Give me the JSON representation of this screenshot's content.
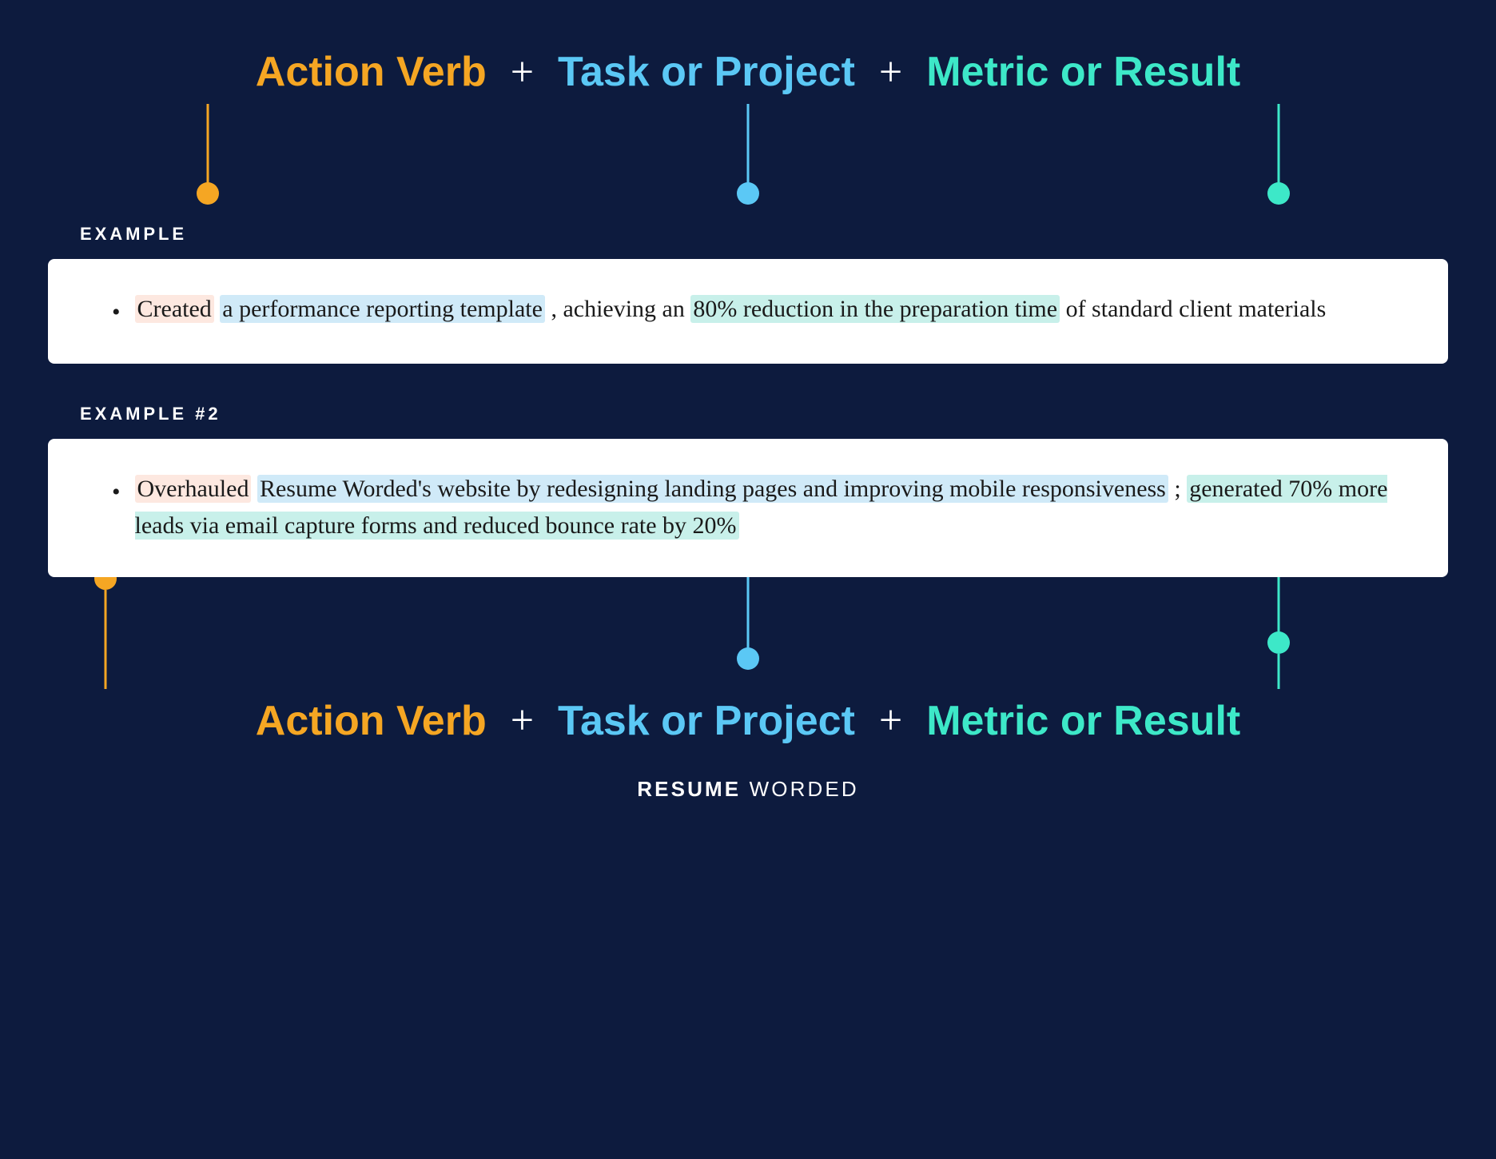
{
  "colors": {
    "background": "#0d1b3e",
    "orange": "#f5a623",
    "blue": "#5bc8f5",
    "teal": "#3de8c8",
    "white": "#ffffff",
    "highlight_orange": "#fde8e0",
    "highlight_blue": "#d0eaf8",
    "highlight_teal": "#c8f0ea"
  },
  "header": {
    "action_verb": "Action Verb",
    "task_or_project": "Task or Project",
    "metric_or_result": "Metric or Result",
    "plus": "+"
  },
  "example1": {
    "label": "EXAMPLE",
    "text_plain": "Created",
    "text_task": "a performance reporting template",
    "text_middle": ", achieving an ",
    "text_metric": "80% reduction in the preparation time",
    "text_end": "of standard client materials"
  },
  "example2": {
    "label": "EXAMPLE #2",
    "text_action": "Overhauled",
    "text_task1": "Resume Worded's website by redesigning landing pages and improving mobile responsiveness",
    "text_middle": "; ",
    "text_metric": "generated 70% more leads via email capture forms and reduced bounce rate by 20%",
    "text_end": ""
  },
  "branding": {
    "resume": "RESUME",
    "worded": "WORDED"
  }
}
